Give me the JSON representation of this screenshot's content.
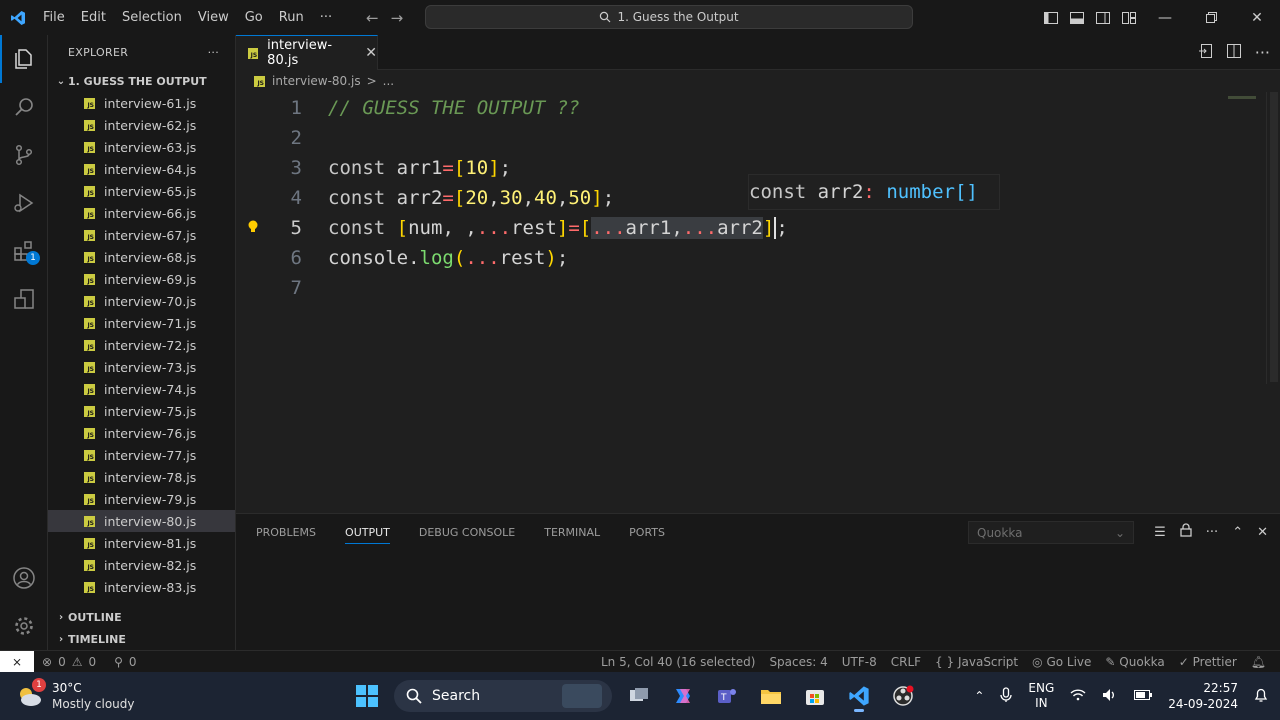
{
  "menu": [
    "File",
    "Edit",
    "Selection",
    "View",
    "Go",
    "Run",
    "···"
  ],
  "command_center": "1. Guess the Output",
  "explorer": {
    "header": "EXPLORER",
    "more": "···",
    "folder": "1. GUESS THE OUTPUT",
    "files": [
      "interview-61.js",
      "interview-62.js",
      "interview-63.js",
      "interview-64.js",
      "interview-65.js",
      "interview-66.js",
      "interview-67.js",
      "interview-68.js",
      "interview-69.js",
      "interview-70.js",
      "interview-71.js",
      "interview-72.js",
      "interview-73.js",
      "interview-74.js",
      "interview-75.js",
      "interview-76.js",
      "interview-77.js",
      "interview-78.js",
      "interview-79.js",
      "interview-80.js",
      "interview-81.js",
      "interview-82.js",
      "interview-83.js"
    ],
    "selected_file": "interview-80.js",
    "outline": "OUTLINE",
    "timeline": "TIMELINE"
  },
  "activity_badge": "1",
  "tab": {
    "label": "interview-80.js",
    "close": "✕"
  },
  "breadcrumb": {
    "file": "interview-80.js",
    "sep": ">",
    "rest": "..."
  },
  "editor": {
    "line_numbers": [
      "1",
      "2",
      "3",
      "4",
      "5",
      "6",
      "7"
    ],
    "line1": "// GUESS THE OUTPUT ??",
    "kw_const": "const",
    "arr1": "arr1",
    "arr2": "arr2",
    "num10": "10",
    "nums_line4": [
      "20",
      "30",
      "40",
      "50"
    ],
    "num": "num",
    "rest": "rest",
    "spread": "...",
    "console": "console",
    "log": "log",
    "hover": {
      "kw": "const",
      "name": "arr2",
      "colon": ":",
      "type": "number[]"
    }
  },
  "panel": {
    "tabs": [
      "PROBLEMS",
      "OUTPUT",
      "DEBUG CONSOLE",
      "TERMINAL",
      "PORTS"
    ],
    "active_tab": "OUTPUT",
    "select_value": "Quokka"
  },
  "status": {
    "errors": "0",
    "warnings": "0",
    "ports": "0",
    "position": "Ln 5, Col 40 (16 selected)",
    "spaces": "Spaces: 4",
    "encoding": "UTF-8",
    "eol": "CRLF",
    "language": "JavaScript",
    "golive": "Go Live",
    "quokka": "Quokka",
    "prettier": "Prettier"
  },
  "taskbar": {
    "temp": "30°C",
    "weather": "Mostly cloudy",
    "weather_badge": "1",
    "search": "Search",
    "lang1": "ENG",
    "lang2": "IN",
    "time": "22:57",
    "date": "24-09-2024"
  },
  "colors": {
    "accent": "#0078d4",
    "js_icon": "#cbcb41",
    "taskbar": "#1c2433"
  }
}
